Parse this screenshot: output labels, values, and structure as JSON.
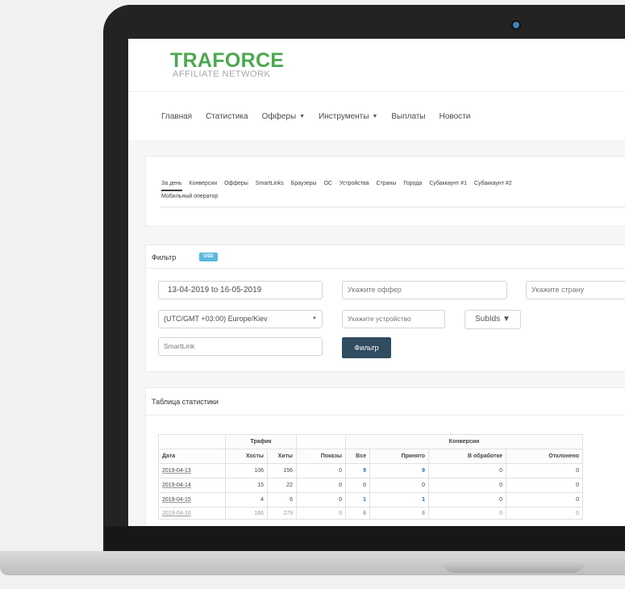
{
  "brand": {
    "name": "TRAFORCE",
    "tagline": "AFFILIATE NETWORK"
  },
  "nav": [
    {
      "label": "Главная"
    },
    {
      "label": "Статистика"
    },
    {
      "label": "Офферы",
      "dropdown": true
    },
    {
      "label": "Инструменты",
      "dropdown": true
    },
    {
      "label": "Выплаты"
    },
    {
      "label": "Новости"
    }
  ],
  "tabs": [
    {
      "label": "За день",
      "active": true
    },
    {
      "label": "Конверсии"
    },
    {
      "label": "Офферы"
    },
    {
      "label": "SmartLinks"
    },
    {
      "label": "Браузеры"
    },
    {
      "label": "ОС"
    },
    {
      "label": "Устройства"
    },
    {
      "label": "Страны"
    },
    {
      "label": "Города"
    },
    {
      "label": "Субаккаунт #1"
    },
    {
      "label": "Субаккаунт #2"
    },
    {
      "label": "Мобильный оператор"
    }
  ],
  "filter": {
    "title": "Фильтр",
    "currency": "USD",
    "date_range": "13-04-2019 to 16-05-2019",
    "offer_placeholder": "Укажите оффер",
    "country_placeholder": "Укажите страну",
    "timezone": "(UTC/GMT +03:00) Europe/Kiev",
    "device_placeholder": "Укажите устройство",
    "subids_label": "SubIds ▼",
    "smartlink_placeholder": "SmartLink",
    "submit_label": "Фильтр"
  },
  "stats": {
    "title": "Таблица статистики",
    "group_traffic": "Трафик",
    "group_conversions": "Конверсии",
    "columns": [
      "Дата",
      "Хосты",
      "Хиты",
      "Показы",
      "Все",
      "Принято",
      "В обработке",
      "Отклонено"
    ],
    "rows": [
      {
        "date": "2019-04-13",
        "hosts": "106",
        "hits": "156",
        "shows": "0",
        "all": "9",
        "accepted": "9",
        "pending": "0",
        "rejected": "0"
      },
      {
        "date": "2019-04-14",
        "hosts": "15",
        "hits": "22",
        "shows": "0",
        "all": "0",
        "accepted": "0",
        "pending": "0",
        "rejected": "0"
      },
      {
        "date": "2019-04-15",
        "hosts": "4",
        "hits": "6",
        "shows": "0",
        "all": "1",
        "accepted": "1",
        "pending": "0",
        "rejected": "0"
      },
      {
        "date": "2019-04-16",
        "hosts": "166",
        "hits": "279",
        "shows": "0",
        "all": "6",
        "accepted": "6",
        "pending": "0",
        "rejected": "0"
      }
    ]
  }
}
